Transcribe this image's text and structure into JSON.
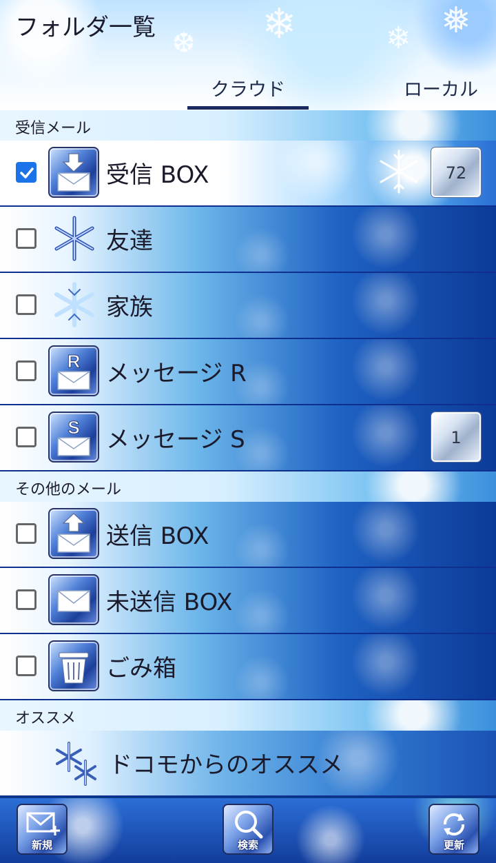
{
  "header": {
    "title": "フォルダ一覧",
    "tabs": [
      {
        "label": "クラウド",
        "selected": true
      },
      {
        "label": "ローカル",
        "selected": false
      }
    ]
  },
  "sections": [
    {
      "label": "受信メール"
    },
    {
      "label": "その他のメール"
    },
    {
      "label": "オススメ"
    }
  ],
  "folders": [
    {
      "label": "受信 BOX",
      "checked": true,
      "icon": "inbox-icon",
      "badge": "72"
    },
    {
      "label": "友達",
      "checked": false,
      "icon": "snowflake-icon",
      "badge": ""
    },
    {
      "label": "家族",
      "checked": false,
      "icon": "snowflake-icon",
      "badge": ""
    },
    {
      "label": "メッセージ R",
      "checked": false,
      "icon": "message-r-icon",
      "badge": ""
    },
    {
      "label": "メッセージ S",
      "checked": false,
      "icon": "message-s-icon",
      "badge": "1"
    },
    {
      "label": "送信 BOX",
      "checked": false,
      "icon": "outbox-icon",
      "badge": ""
    },
    {
      "label": "未送信 BOX",
      "checked": false,
      "icon": "envelope-icon",
      "badge": ""
    },
    {
      "label": "ごみ箱",
      "checked": false,
      "icon": "trash-icon",
      "badge": ""
    }
  ],
  "recommend": {
    "label": "ドコモからのオススメ",
    "icon": "snowflake-cluster-icon"
  },
  "bottom_bar": {
    "new_label": "新規",
    "search_label": "検索",
    "refresh_label": "更新"
  },
  "colors": {
    "accent": "#1a73e8",
    "tab_indicator": "#1a2a60",
    "row_border": "#0f2f8e"
  }
}
